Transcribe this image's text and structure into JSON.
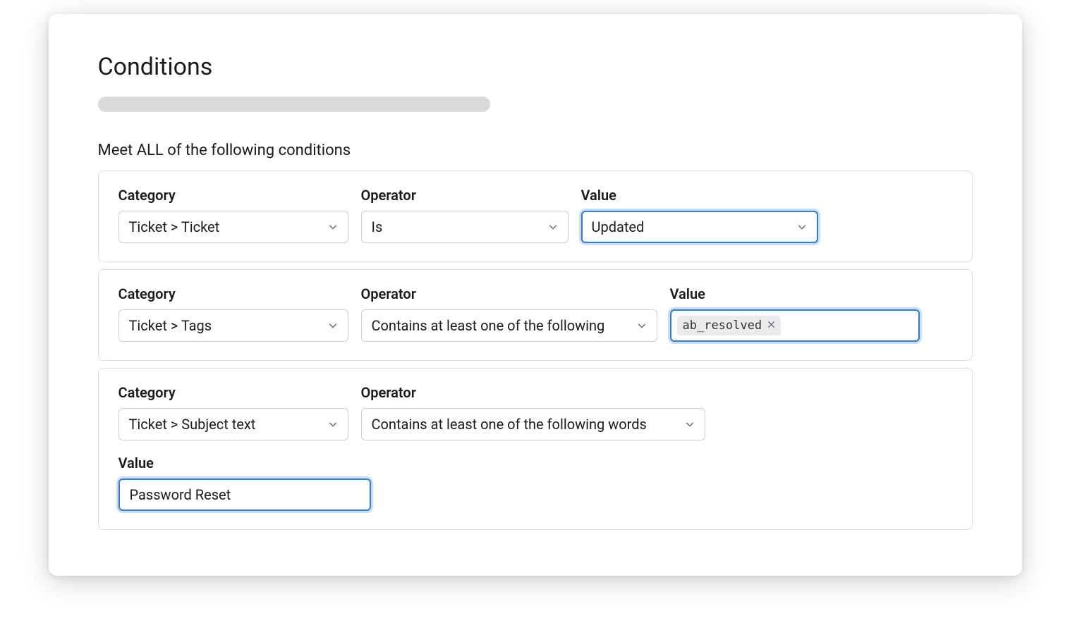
{
  "title": "Conditions",
  "subtitle": "Meet ALL of the following conditions",
  "labels": {
    "category": "Category",
    "operator": "Operator",
    "value": "Value"
  },
  "rows": [
    {
      "category": "Ticket > Ticket",
      "operator": "Is",
      "value": "Updated"
    },
    {
      "category": "Ticket > Tags",
      "operator": "Contains at least one of the following",
      "tag": "ab_resolved"
    },
    {
      "category": "Ticket > Subject text",
      "operator": "Contains at least one of the following words",
      "value": "Password Reset"
    }
  ]
}
